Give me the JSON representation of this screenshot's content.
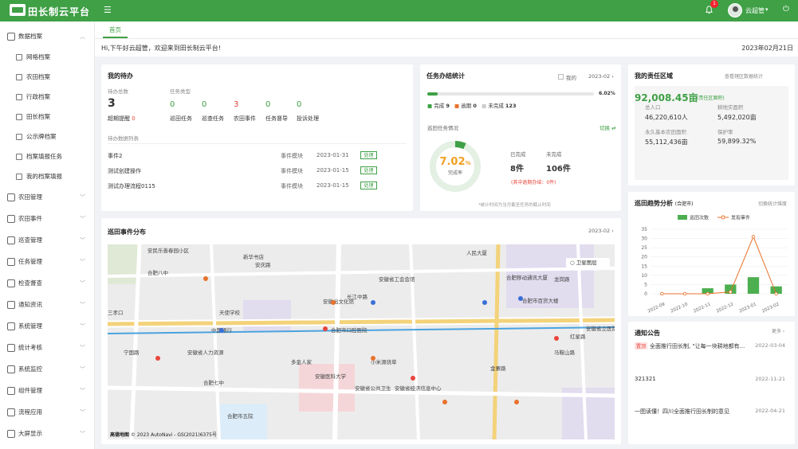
{
  "header": {
    "app_title": "田长制云平台",
    "notification_count": "1",
    "username": "云超管"
  },
  "sidebar": {
    "items": [
      {
        "label": "数据档案",
        "icon": "folder-icon",
        "expanded": true
      },
      {
        "label": "网格档案",
        "icon": "grid-icon",
        "sub": true
      },
      {
        "label": "农田档案",
        "icon": "field-icon",
        "sub": true
      },
      {
        "label": "行政档案",
        "icon": "admin-icon",
        "sub": true
      },
      {
        "label": "田长档案",
        "icon": "person-icon",
        "sub": true
      },
      {
        "label": "公示牌档案",
        "icon": "sign-icon",
        "sub": true
      },
      {
        "label": "档案填报任务",
        "icon": "task-icon",
        "sub": true
      },
      {
        "label": "我的档案填报",
        "icon": "form-icon",
        "sub": true
      },
      {
        "label": "农田管理",
        "icon": "map-icon"
      },
      {
        "label": "农田事件",
        "icon": "event-icon"
      },
      {
        "label": "巡查管理",
        "icon": "patrol-icon"
      },
      {
        "label": "任务管理",
        "icon": "list-icon"
      },
      {
        "label": "检查督查",
        "icon": "user-icon"
      },
      {
        "label": "通知资讯",
        "icon": "bell-icon"
      },
      {
        "label": "系统管理",
        "icon": "gear-icon"
      },
      {
        "label": "统计考核",
        "icon": "chart-icon"
      },
      {
        "label": "系统监控",
        "icon": "monitor-icon"
      },
      {
        "label": "组件管理",
        "icon": "component-icon"
      },
      {
        "label": "流程应用",
        "icon": "flow-icon"
      },
      {
        "label": "大屏显示",
        "icon": "screen-icon"
      }
    ]
  },
  "tabs": [
    {
      "label": "首页"
    }
  ],
  "greeting": "Hi,下午好云超管，欢迎来到田长制云平台!",
  "date": "2023年02月21日",
  "todo": {
    "title": "我的待办",
    "pending_label": "待办总数",
    "pending_count": "3",
    "overdue_label": "超期提醒",
    "overdue_count": "0",
    "types_label": "任务类型",
    "types": [
      {
        "count": "0",
        "label": "巡田任务",
        "color": "#3fa046"
      },
      {
        "count": "0",
        "label": "巡查任务",
        "color": "#3fa046"
      },
      {
        "count": "3",
        "label": "农田事件",
        "color": "#e8453c"
      },
      {
        "count": "0",
        "label": "任务督导",
        "color": "#3fa046"
      },
      {
        "count": "0",
        "label": "投诉处理",
        "color": "#3fa046"
      }
    ],
    "list_label": "待办数据列表",
    "rows": [
      {
        "name": "事件2",
        "module": "事件模块",
        "date": "2023-01-31",
        "action": "处理"
      },
      {
        "name": "测试创建操作",
        "module": "事件模块",
        "date": "2023-01-15",
        "action": "处理"
      },
      {
        "name": "测试办理流程0115",
        "module": "事件模块",
        "date": "2023-01-15",
        "action": "处理"
      }
    ]
  },
  "task_stats": {
    "title": "任务办结统计",
    "mine_label": "我的",
    "month": "2023-02",
    "progress_pct": "6.02%",
    "progress_value": 0.0602,
    "done_label": "完成",
    "done": "9",
    "overdue_label": "逾期",
    "overdue": "0",
    "undone_label": "未完成",
    "undone": "123",
    "patrol_label": "巡田任务情况",
    "switch_label": "切换",
    "rate_value": "7.02",
    "rate_unit": "%",
    "rate_fraction": 0.0702,
    "rate_label": "完成率",
    "completed_label": "已完成",
    "completed": "8件",
    "uncompleted_label": "未完成",
    "uncompleted": "106件",
    "overdue_note": "(其中逾期办结：0件)",
    "footnote": "*统计时间为当月截至任务的截止时间"
  },
  "responsibility": {
    "title": "我的责任区域",
    "link": "查看辖区数据统计",
    "area_value": "92,008.45亩",
    "area_label": "(责任区面积)",
    "stats": [
      {
        "label": "总人口",
        "value": "46,220,610人"
      },
      {
        "label": "耕地实面积",
        "value": "5,492,020亩"
      },
      {
        "label": "永久基本农田面积",
        "value": "55,112,436亩"
      },
      {
        "label": "保护率",
        "value": "59,899.32%"
      }
    ]
  },
  "map": {
    "title": "巡田事件分布",
    "month": "2023-02",
    "satellite_label": "卫星图层",
    "attribution": "© 2023 AutoNavi - GS(2021)6375号",
    "logo": "高德地图",
    "labels": [
      "安民乐善春园小区",
      "合肥八中",
      "新华书店",
      "人民大厦",
      "安庆路",
      "龙岗路",
      "金寨路",
      "长江中路",
      "天使学校",
      "中国银行",
      "安徽省人力资源",
      "合肥七中",
      "安徽省工会会馆",
      "安徽出文化馆",
      "合肥市口腔医院",
      "安徽医科大学",
      "安徽省公共卫生",
      "安徽省经济信息中心",
      "小米源烧草",
      "多金人家",
      "合肥市五院",
      "合肥移动通讯大厦",
      "合肥市百货大楼",
      "三孝口",
      "宁国路",
      "马鞍山路",
      "红星路",
      "安徽省立医院"
    ]
  },
  "chart_data": {
    "type": "bar",
    "title": "巡田趋势分析",
    "subtitle": "(合肥市)",
    "link": "切换统计维度",
    "categories": [
      "2022-09",
      "2022-10",
      "2022-11",
      "2022-12",
      "2023-01",
      "2023-02"
    ],
    "series": [
      {
        "name": "巡田次数",
        "type": "bar",
        "color": "#4caf50",
        "values": [
          0,
          0,
          3,
          5,
          9,
          4
        ]
      },
      {
        "name": "发现事件",
        "type": "line",
        "color": "#e8722c",
        "values": [
          0,
          0,
          0,
          1,
          31,
          0
        ]
      }
    ],
    "ylim": [
      0,
      35
    ],
    "yticks": [
      0,
      5,
      10,
      15,
      20,
      25,
      30,
      35
    ],
    "grid": true,
    "legend": "top"
  },
  "notices": {
    "title": "通知公告",
    "more": "更多",
    "items": [
      {
        "tag": "置顶",
        "text": "全面推行田长制, \"让每一块耕地都有...",
        "date": "2022-03-04"
      },
      {
        "tag": "",
        "text": "321321",
        "date": "2022-11-21"
      },
      {
        "tag": "",
        "text": "一图读懂！四川全面推行田长制的意见",
        "date": "2022-04-21"
      }
    ]
  },
  "colors": {
    "primary": "#3fa046",
    "danger": "#e8453c"
  }
}
